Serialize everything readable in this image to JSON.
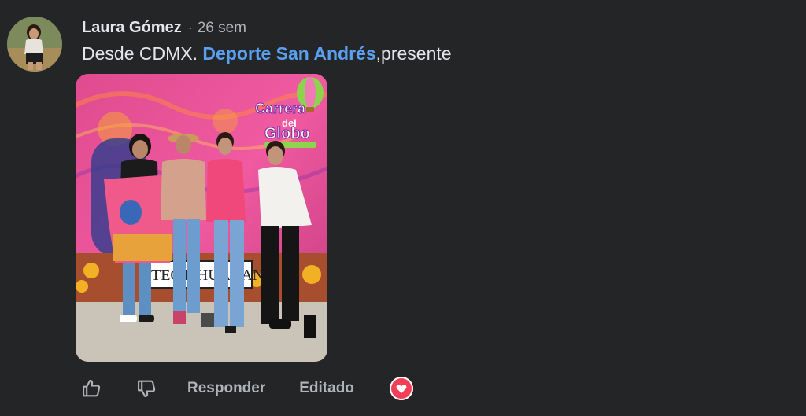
{
  "comment": {
    "author": "Laura Gómez",
    "separator": "·",
    "time": "26 sem",
    "text_prefix": "Desde CDMX. ",
    "mention": "Deporte San Andrés",
    "text_suffix": ",presente"
  },
  "photo": {
    "banner_title_1": "Carrera",
    "banner_title_2": "del",
    "banner_title_3": "Globo",
    "sign_text": "TEOTIHUACAN"
  },
  "actions": {
    "like_icon": "thumbs-up-icon",
    "dislike_icon": "thumbs-down-icon",
    "reply_label": "Responder",
    "edited_label": "Editado",
    "reaction_icon": "heart-reaction-icon"
  },
  "colors": {
    "background": "#242526",
    "text": "#e4e6eb",
    "secondary_text": "#b0b3b8",
    "mention": "#5aa0f2",
    "heart": "#f33e58"
  }
}
